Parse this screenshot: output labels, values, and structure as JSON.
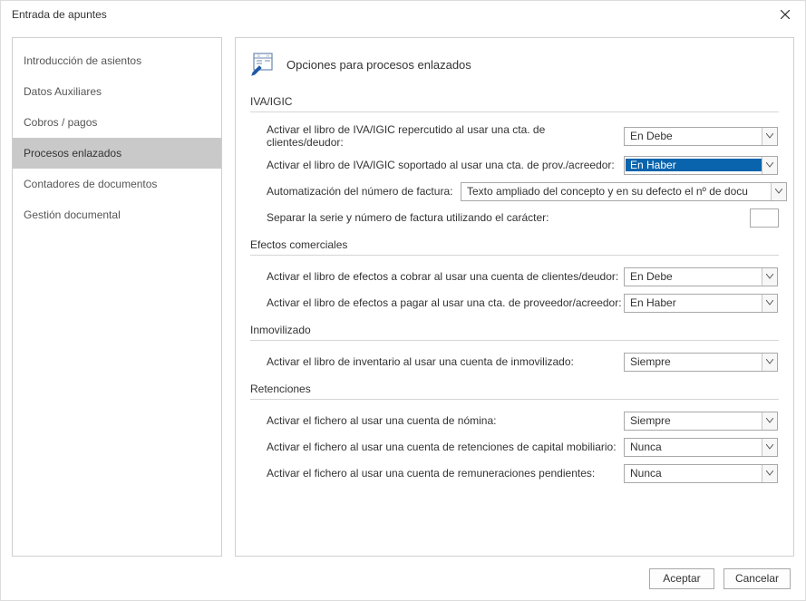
{
  "dialog": {
    "title": "Entrada de apuntes"
  },
  "sidebar": {
    "items": [
      {
        "label": "Introducción de asientos"
      },
      {
        "label": "Datos Auxiliares"
      },
      {
        "label": "Cobros / pagos"
      },
      {
        "label": "Procesos enlazados"
      },
      {
        "label": "Contadores de documentos"
      },
      {
        "label": "Gestión documental"
      }
    ],
    "selected_index": 3
  },
  "main": {
    "title": "Opciones para procesos enlazados",
    "sections": {
      "iva": {
        "title": "IVA/IGIC",
        "row1_label": "Activar el libro de IVA/IGIC repercutido al usar una cta. de clientes/deudor:",
        "row1_value": "En Debe",
        "row2_label": "Activar el libro de IVA/IGIC soportado al usar una cta. de prov./acreedor:",
        "row2_value": "En Haber",
        "row3_label": "Automatización del número de factura:",
        "row3_value": "Texto ampliado del concepto y en su defecto el nº de docu",
        "row4_label": "Separar la serie y número de factura utilizando el carácter:",
        "row4_value": ""
      },
      "efectos": {
        "title": "Efectos comerciales",
        "row1_label": "Activar el libro de efectos a cobrar al usar una cuenta de clientes/deudor:",
        "row1_value": "En Debe",
        "row2_label": "Activar el libro de efectos a pagar al usar una cta. de proveedor/acreedor:",
        "row2_value": "En Haber"
      },
      "inmovilizado": {
        "title": "Inmovilizado",
        "row1_label": "Activar el libro de inventario al usar una cuenta de inmovilizado:",
        "row1_value": "Siempre"
      },
      "retenciones": {
        "title": "Retenciones",
        "row1_label": "Activar el fichero al usar una cuenta de nómina:",
        "row1_value": "Siempre",
        "row2_label": "Activar el fichero al usar una cuenta de retenciones de capital mobiliario:",
        "row2_value": "Nunca",
        "row3_label": "Activar el fichero al usar una cuenta de remuneraciones pendientes:",
        "row3_value": "Nunca"
      }
    }
  },
  "footer": {
    "accept": "Aceptar",
    "cancel": "Cancelar"
  },
  "select_options": {
    "activar": [
      "En Debe",
      "En Haber",
      "Siempre",
      "Nunca"
    ]
  }
}
